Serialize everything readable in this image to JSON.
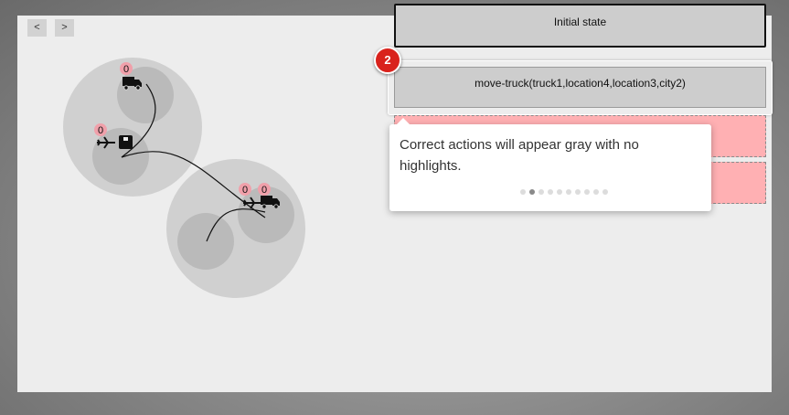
{
  "nav": {
    "prev_label": "<",
    "next_label": ">"
  },
  "scene": {
    "counters": {
      "truck_top": "0",
      "plane": "0",
      "plane_right": "0",
      "truck_right": "0"
    }
  },
  "steps": [
    {
      "label": "Initial state"
    },
    {
      "label": "move-truck(truck1,location4,location3,city2)"
    }
  ],
  "tour": {
    "step_number": "2",
    "message": "Correct actions will appear gray with no highlights.",
    "dots_total": 10,
    "active_dot": 1
  },
  "colors": {
    "correct_step": "#cdcdcd",
    "pending_step": "#ffb0b3",
    "badge": "#d9221c"
  }
}
